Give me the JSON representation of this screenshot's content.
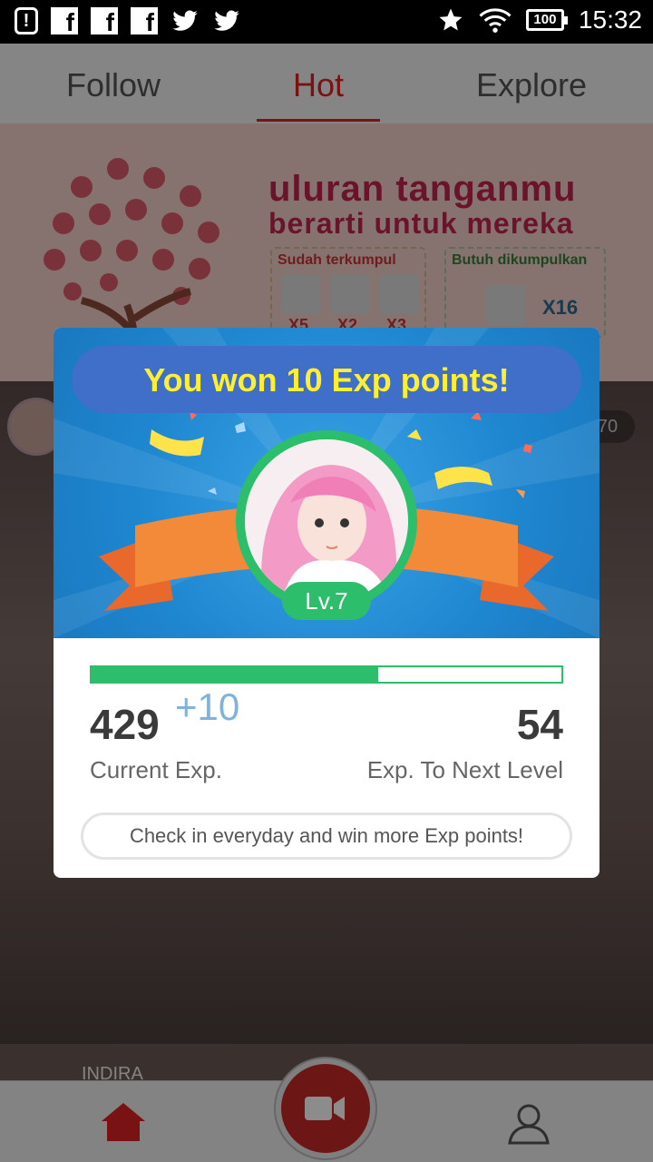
{
  "status_bar": {
    "notification_glyph": "!",
    "facebook_glyph": "f",
    "battery": "100",
    "time": "15:32",
    "icons": [
      "notification-icon",
      "facebook-icon",
      "facebook-icon",
      "facebook-icon",
      "twitter-icon",
      "twitter-icon",
      "star-icon",
      "wifi-icon",
      "battery-icon"
    ]
  },
  "tabs": [
    {
      "label": "Follow",
      "active": false
    },
    {
      "label": "Hot",
      "active": true
    },
    {
      "label": "Explore",
      "active": false
    }
  ],
  "banner": {
    "title_line1": "uluran tanganmu",
    "title_line2": "berarti untuk mereka",
    "collected_label": "Sudah terkumpul",
    "collected_items": [
      "X5",
      "X2",
      "X3"
    ],
    "needed_label": "Butuh dikumpulkan",
    "needed_count": "X16"
  },
  "feed": {
    "viewer_count": "70",
    "streamer_name": "INDIRA"
  },
  "dialog": {
    "title": "You won 10 Exp points!",
    "level": "Lv.7",
    "progress_fraction": 0.61,
    "current_exp": "429",
    "exp_gain": "+10",
    "exp_to_next": "54",
    "current_exp_label": "Current Exp.",
    "exp_to_next_label": "Exp. To Next Level",
    "checkin_hint": "Check in everyday and win more Exp points!"
  },
  "colors": {
    "accent_red": "#d22222",
    "exp_green": "#2dbe6b",
    "title_yellow": "#ffef33",
    "header_blue": "#1e86cf"
  }
}
